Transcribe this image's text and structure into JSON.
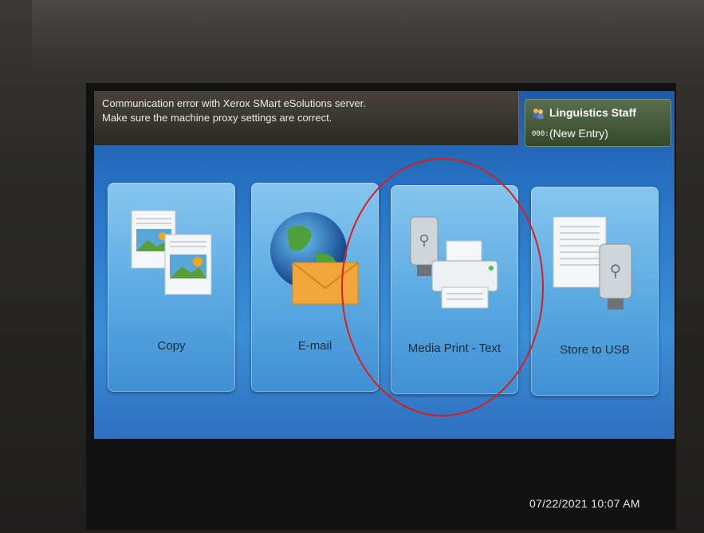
{
  "message": {
    "line1": "Communication error with Xerox SMart eSolutions server.",
    "line2": "Make sure the machine proxy settings are correct."
  },
  "user": {
    "name": "Linguistics Staff",
    "entry": "(New Entry)",
    "key_glyph": "000:"
  },
  "tiles": [
    {
      "label": "Copy",
      "icon": "copy-icon"
    },
    {
      "label": "E-mail",
      "icon": "email-icon"
    },
    {
      "label": "Media Print - Text",
      "icon": "media-print-icon"
    },
    {
      "label": "Store to USB",
      "icon": "store-usb-icon"
    }
  ],
  "datetime": "07/22/2021 10:07 AM",
  "colors": {
    "highlight_circle": "#d81e1e",
    "screen_blue": "#2a77c8",
    "tile_blue": "#5aa9e2"
  }
}
